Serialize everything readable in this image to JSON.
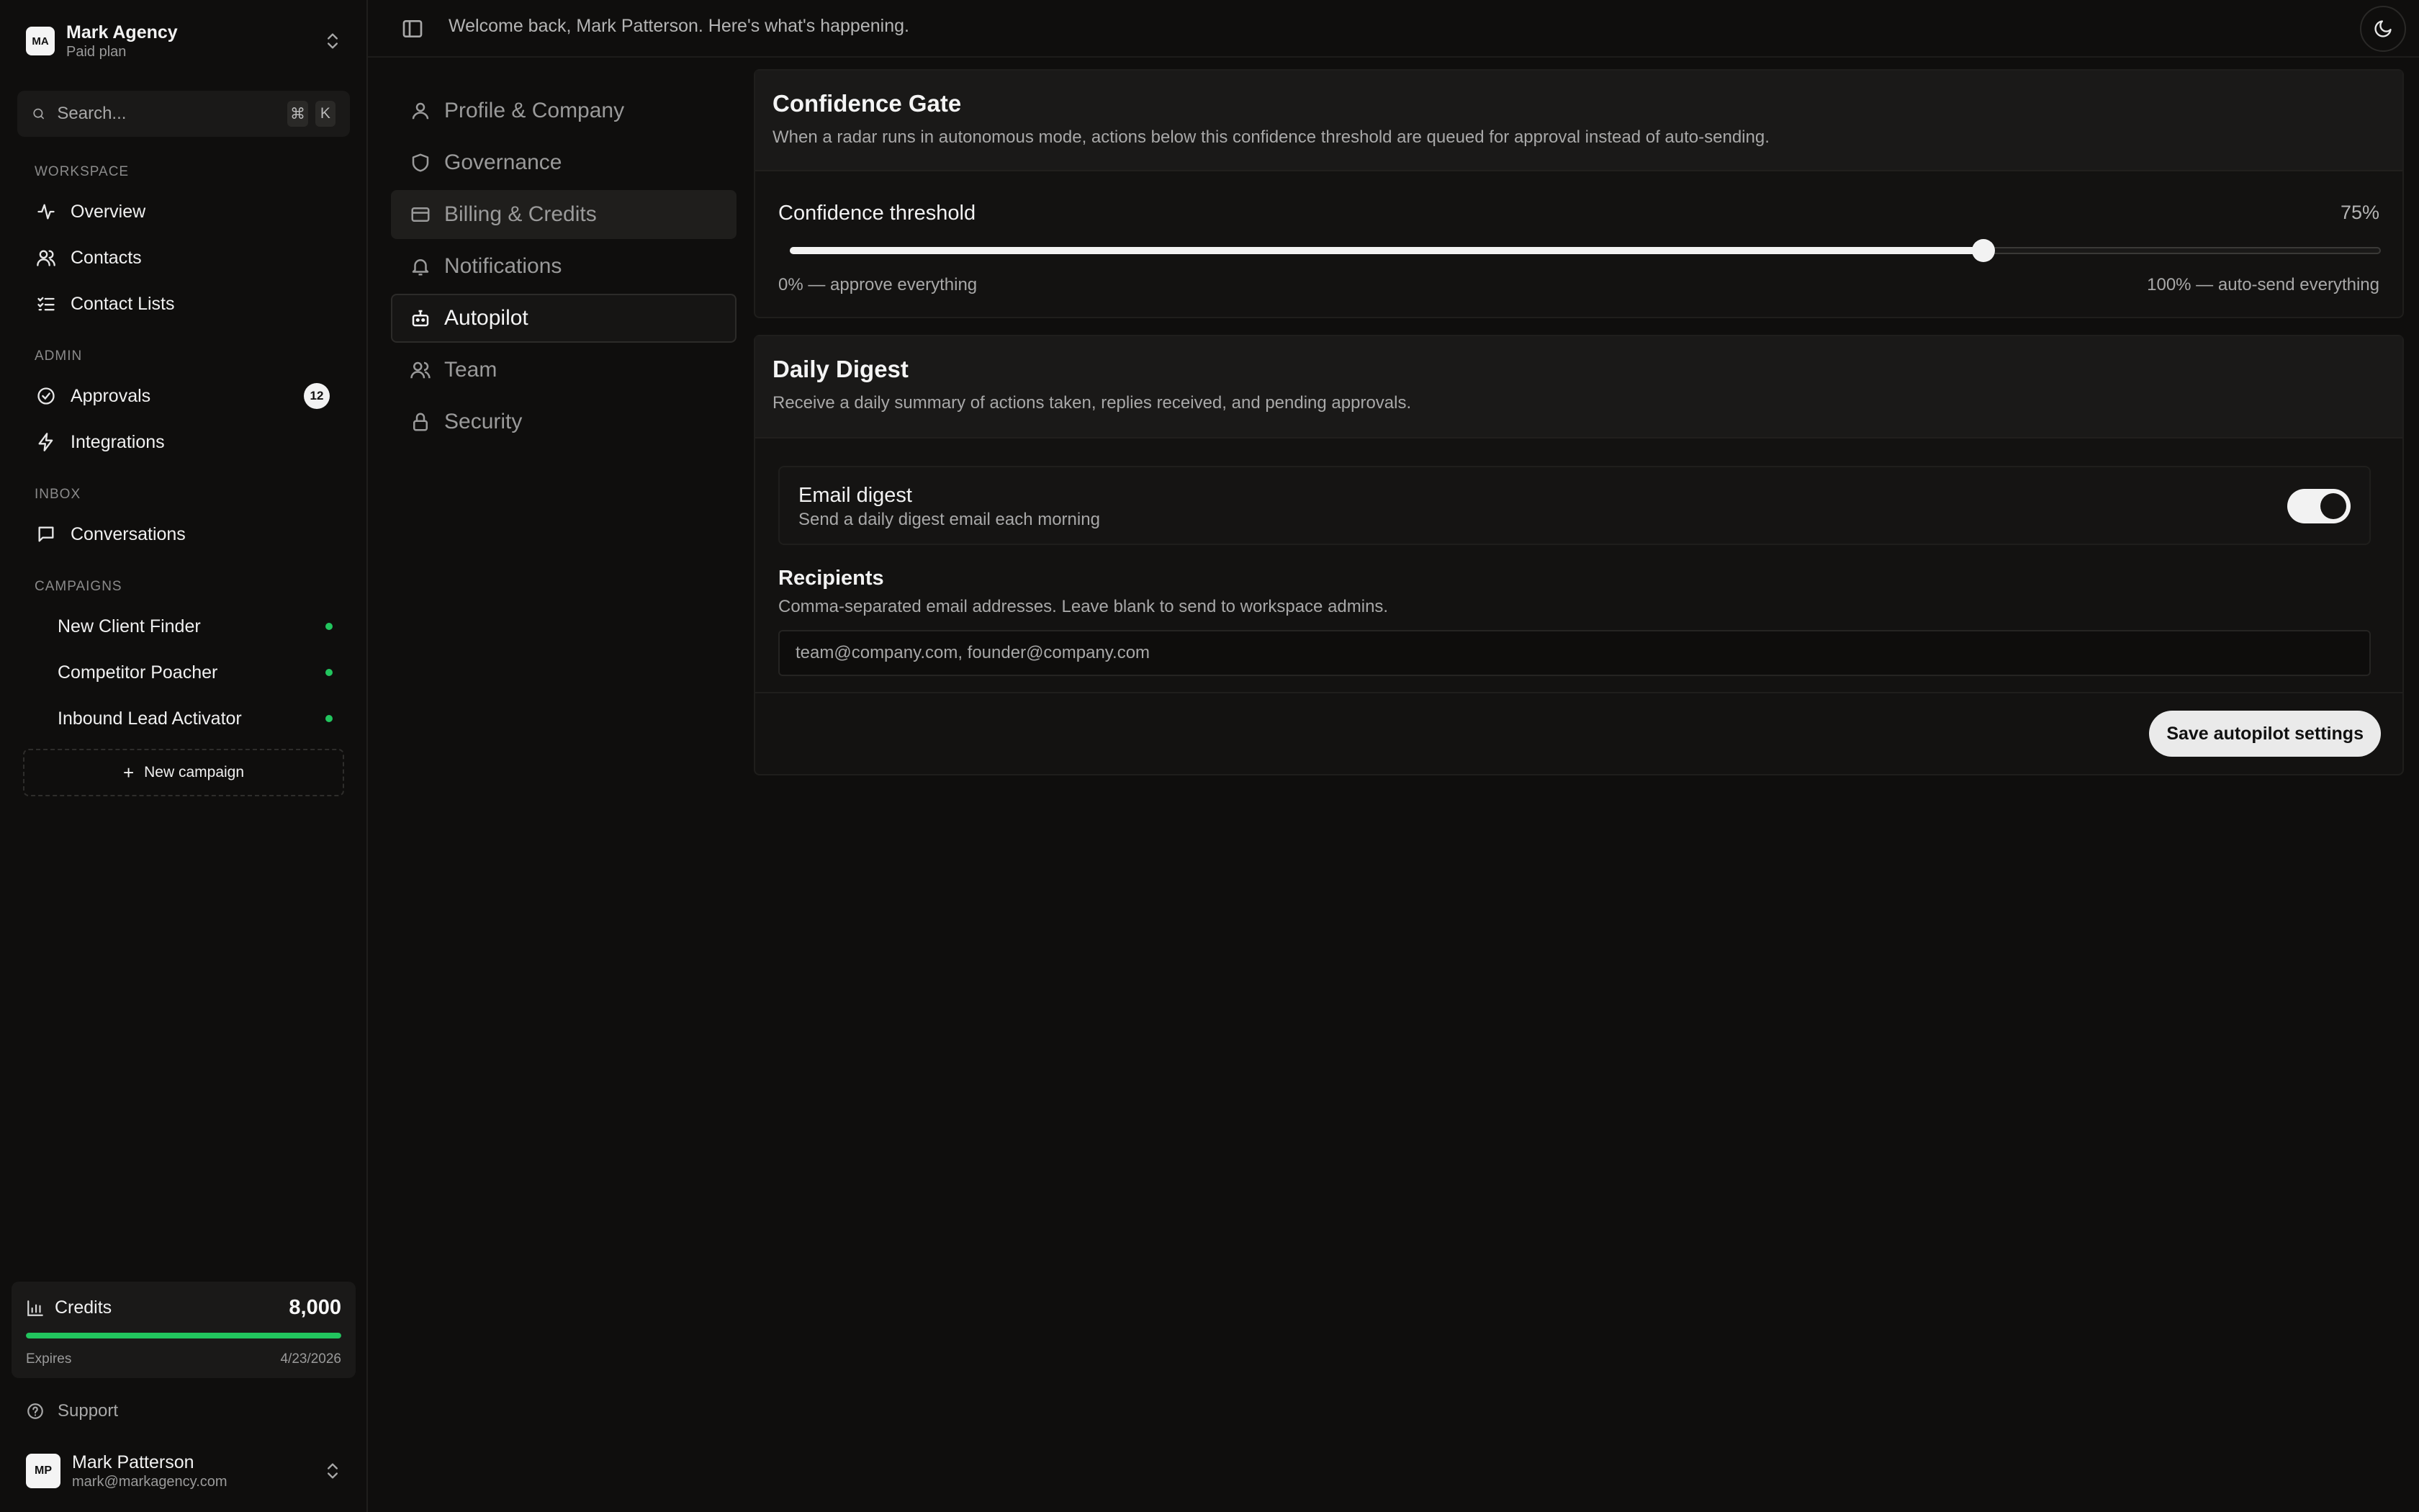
{
  "workspace": {
    "initials": "MA",
    "name": "Mark Agency",
    "plan": "Paid plan"
  },
  "search": {
    "placeholder": "Search...",
    "shortcut": [
      "⌘",
      "K"
    ]
  },
  "sidebar": {
    "sections": {
      "workspace": "WORKSPACE",
      "admin": "ADMIN",
      "inbox": "INBOX",
      "campaigns": "CAMPAIGNS"
    },
    "workspace_items": [
      {
        "label": "Overview",
        "icon": "activity-icon"
      },
      {
        "label": "Contacts",
        "icon": "users-icon"
      },
      {
        "label": "Contact Lists",
        "icon": "list-check-icon"
      }
    ],
    "admin_items": [
      {
        "label": "Approvals",
        "icon": "check-circle-icon",
        "badge": "12"
      },
      {
        "label": "Integrations",
        "icon": "zap-icon"
      }
    ],
    "inbox_items": [
      {
        "label": "Conversations",
        "icon": "message-square-icon"
      }
    ],
    "campaigns": [
      {
        "label": "New Client Finder",
        "status": "active"
      },
      {
        "label": "Competitor Poacher",
        "status": "active"
      },
      {
        "label": "Inbound Lead Activator",
        "status": "active"
      }
    ],
    "new_campaign": "New campaign"
  },
  "credits": {
    "label": "Credits",
    "value": "8,000",
    "progress": 1.0,
    "expires_label": "Expires",
    "expires_date": "4/23/2026"
  },
  "support": "Support",
  "user": {
    "initials": "MP",
    "name": "Mark Patterson",
    "email": "mark@markagency.com"
  },
  "topbar": {
    "welcome": "Welcome back, Mark Patterson. Here's what's happening."
  },
  "settings_nav": [
    {
      "label": "Profile & Company",
      "icon": "user-icon",
      "state": "default"
    },
    {
      "label": "Governance",
      "icon": "shield-icon",
      "state": "default"
    },
    {
      "label": "Billing & Credits",
      "icon": "credit-card-icon",
      "state": "hover"
    },
    {
      "label": "Notifications",
      "icon": "bell-icon",
      "state": "default"
    },
    {
      "label": "Autopilot",
      "icon": "bot-icon",
      "state": "active"
    },
    {
      "label": "Team",
      "icon": "users-icon",
      "state": "default"
    },
    {
      "label": "Security",
      "icon": "lock-icon",
      "state": "default"
    }
  ],
  "confidence_gate": {
    "title": "Confidence Gate",
    "description": "When a radar runs in autonomous mode, actions below this confidence threshold are queued for approval instead of auto-sending.",
    "threshold_label": "Confidence threshold",
    "threshold_value": 75,
    "threshold_display": "75%",
    "min_label": "0% — approve everything",
    "max_label": "100% — auto-send everything"
  },
  "daily_digest": {
    "title": "Daily Digest",
    "description": "Receive a daily summary of actions taken, replies received, and pending approvals.",
    "email_digest_title": "Email digest",
    "email_digest_sub": "Send a daily digest email each morning",
    "email_digest_enabled": true,
    "recipients_title": "Recipients",
    "recipients_help": "Comma-separated email addresses. Leave blank to send to workspace admins.",
    "recipients_placeholder": "team@company.com, founder@company.com",
    "recipients_value": "",
    "save_label": "Save autopilot settings"
  },
  "colors": {
    "accent_green": "#22c55e",
    "background": "#0f0e0d"
  }
}
